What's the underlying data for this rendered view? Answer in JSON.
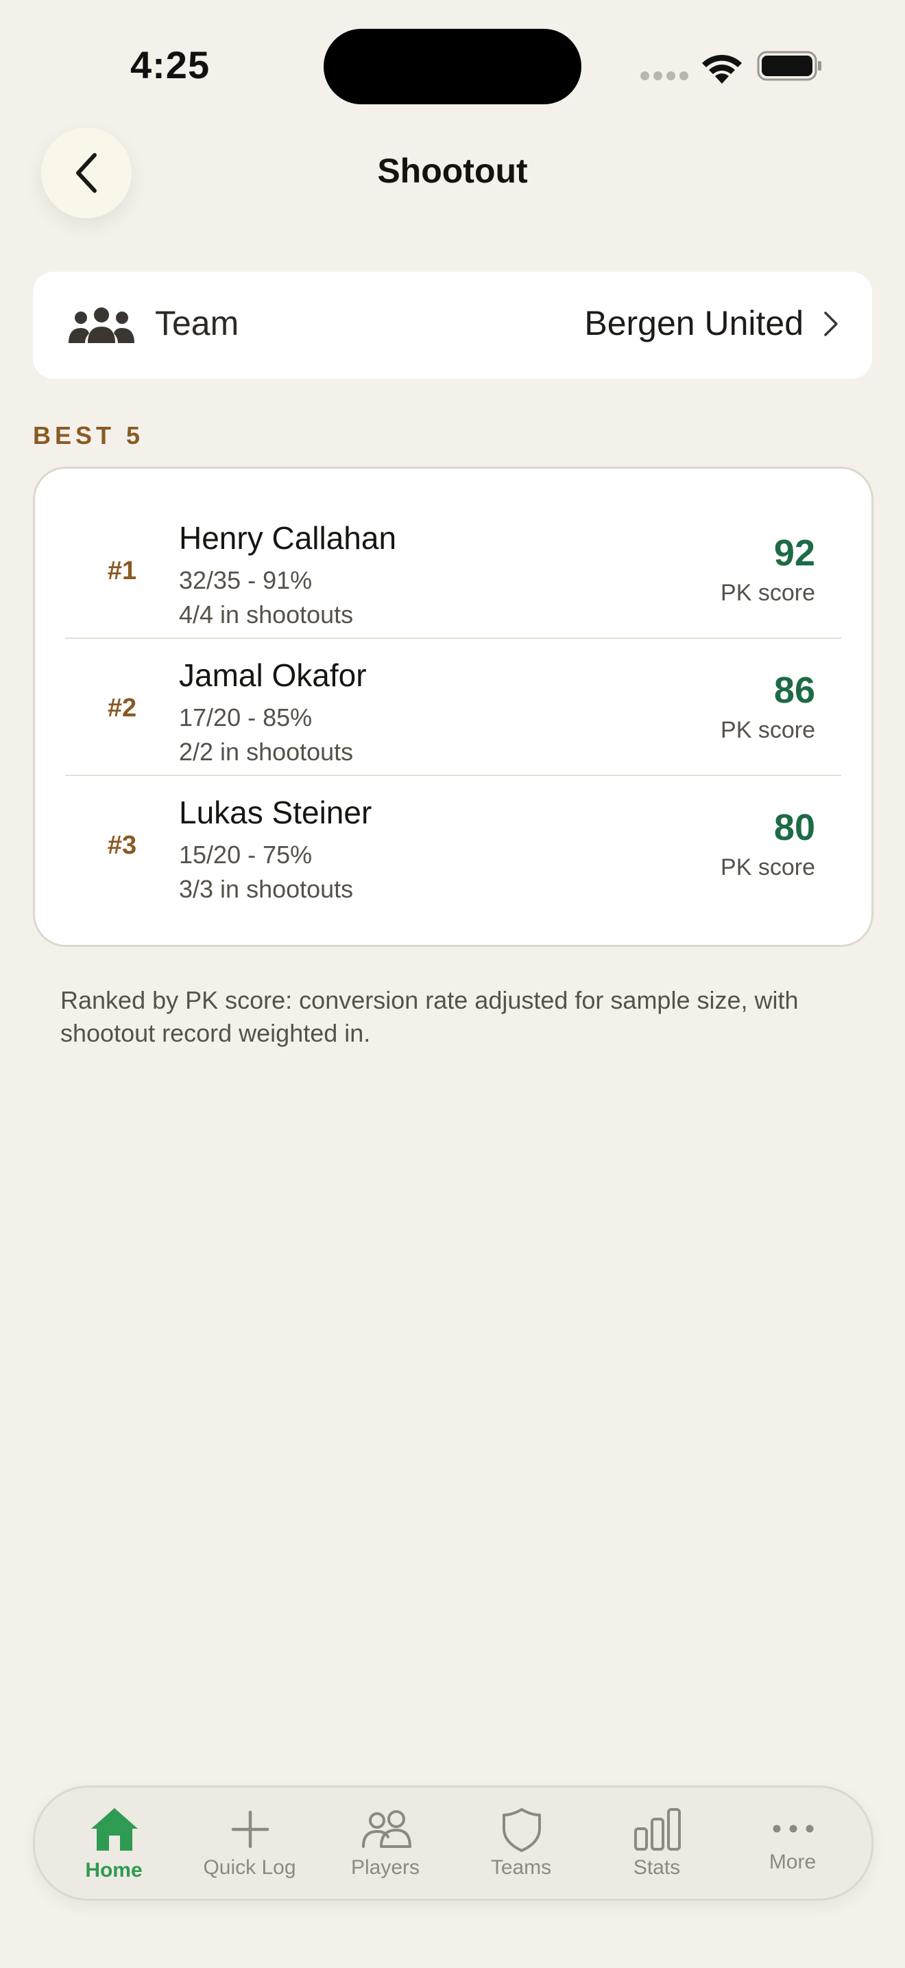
{
  "status_bar": {
    "time": "4:25"
  },
  "header": {
    "title": "Shootout",
    "back_icon": "chevron-left-icon"
  },
  "team_selector": {
    "label": "Team",
    "value": "Bergen United",
    "icon": "people-icon"
  },
  "section": {
    "label": "BEST 5"
  },
  "rankings": [
    {
      "rank": "#1",
      "name": "Henry Callahan",
      "conversion": "32/35 - 91%",
      "shootouts": "4/4 in shootouts",
      "pk_score": "92",
      "pk_label": "PK score"
    },
    {
      "rank": "#2",
      "name": "Jamal Okafor",
      "conversion": "17/20 - 85%",
      "shootouts": "2/2 in shootouts",
      "pk_score": "86",
      "pk_label": "PK score"
    },
    {
      "rank": "#3",
      "name": "Lukas Steiner",
      "conversion": "15/20 - 75%",
      "shootouts": "3/3 in shootouts",
      "pk_score": "80",
      "pk_label": "PK score"
    }
  ],
  "footnote": "Ranked by PK score: conversion rate adjusted for sample size, with shootout record weighted in.",
  "tab_bar": {
    "items": [
      {
        "label": "Home",
        "icon": "home-icon",
        "active": true
      },
      {
        "label": "Quick Log",
        "icon": "plus-icon",
        "active": false
      },
      {
        "label": "Players",
        "icon": "players-icon",
        "active": false
      },
      {
        "label": "Teams",
        "icon": "shield-icon",
        "active": false
      },
      {
        "label": "Stats",
        "icon": "bar-chart-icon",
        "active": false
      },
      {
        "label": "More",
        "icon": "more-dots-icon",
        "active": false
      }
    ]
  },
  "colors": {
    "background": "#f4f1ea",
    "accent_brown": "#8a5a24",
    "score_green": "#1d6b45",
    "active_tab_green": "#2f9a52"
  }
}
